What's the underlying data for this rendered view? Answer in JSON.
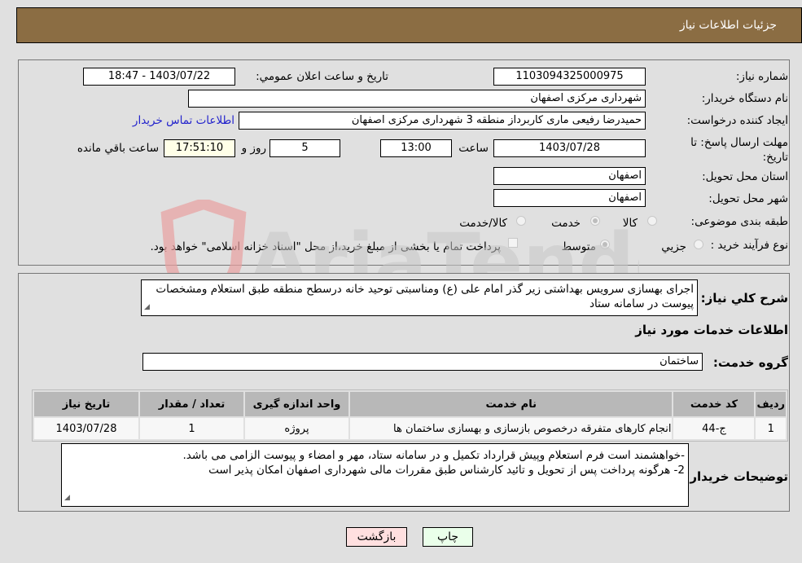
{
  "header": {
    "title": "جزئيات اطلاعات نياز"
  },
  "info": {
    "need_number_label": "شماره نياز:",
    "need_number": "1103094325000975",
    "announce_label": "تاريخ و ساعت اعلان عمومي:",
    "announce_value": "1403/07/22 - 18:47",
    "buyer_org_label": "نام دستگاه خريدار:",
    "buyer_org": "شهرداری مرکزی اصفهان",
    "creator_label": "ايجاد کننده درخواست:",
    "creator": "حمیدرضا رفیعی ماری کاربرداز منطقه 3 شهرداری مرکزی اصفهان",
    "buyer_contact_link": "اطلاعات تماس خريدار",
    "deadline_label": "مهلت ارسال پاسخ: تا تاريخ:",
    "deadline_date": "1403/07/28",
    "time_label": "ساعت",
    "deadline_time": "13:00",
    "days_value": "5",
    "days_label": "روز و",
    "remaining_time": "17:51:10",
    "remaining_label": "ساعت باقي مانده",
    "province_label": "استان محل تحويل:",
    "province": "اصفهان",
    "city_label": "شهر محل تحويل:",
    "city": "اصفهان",
    "category_label": "طبقه بندی موضوعی:",
    "category_options": [
      {
        "label": "کالا",
        "checked": false
      },
      {
        "label": "خدمت",
        "checked": true
      },
      {
        "label": "کالا/خدمت",
        "checked": false
      }
    ],
    "purchase_type_label": "نوع فرآيند خريد :",
    "purchase_options": [
      {
        "label": "جزيي",
        "checked": false
      },
      {
        "label": "متوسط",
        "checked": true
      }
    ],
    "treasury_note": "پرداخت تمام يا بخشی از مبلغ خريد،از محل \"اسناد خزانه اسلامی\" خواهد بود."
  },
  "summary": {
    "label": "شرح كلي نياز:",
    "text": "اجرای بهسازی سرویس بهداشتی زیر گذر امام علی (ع) ومناسبتی توحید خانه درسطح منطقه طبق استعلام ومشخصات پیوست در سامانه ستاد"
  },
  "services": {
    "section_title": "اطلاعات خدمات مورد نياز",
    "group_label": "گروه خدمت:",
    "group_value": "ساختمان",
    "columns": [
      "رديف",
      "کد خدمت",
      "نام خدمت",
      "واحد اندازه گيری",
      "تعداد / مقدار",
      "تاريخ نياز"
    ],
    "rows": [
      [
        "1",
        "ج-44",
        "انجام کارهای متفرقه درخصوص بازسازی و بهسازی ساختمان ها",
        "پروژه",
        "1",
        "1403/07/28"
      ]
    ]
  },
  "buyer_notes": {
    "label": "توضيحات خريدار:",
    "line1": "-خواهشمند است فرم استعلام  وپیش قرارداد تکمیل و در سامانه ستاد، مهر و امضاء و پیوست الزامی می باشد.",
    "line2": "2- هرگونه پرداخت پس از تحویل و تائید کارشناس طبق مقررات مالی شهرداری اصفهان امکان پذیر است"
  },
  "buttons": {
    "print": "چاپ",
    "back": "بازگشت"
  },
  "watermark": {
    "text": "AriaTender.neT"
  },
  "colors": {
    "header_bg": "#8b6d43",
    "print_bg": "#eaffea",
    "back_bg": "#ffe0e0",
    "remaining_bg": "#ffffe8",
    "link": "#2222cc"
  }
}
